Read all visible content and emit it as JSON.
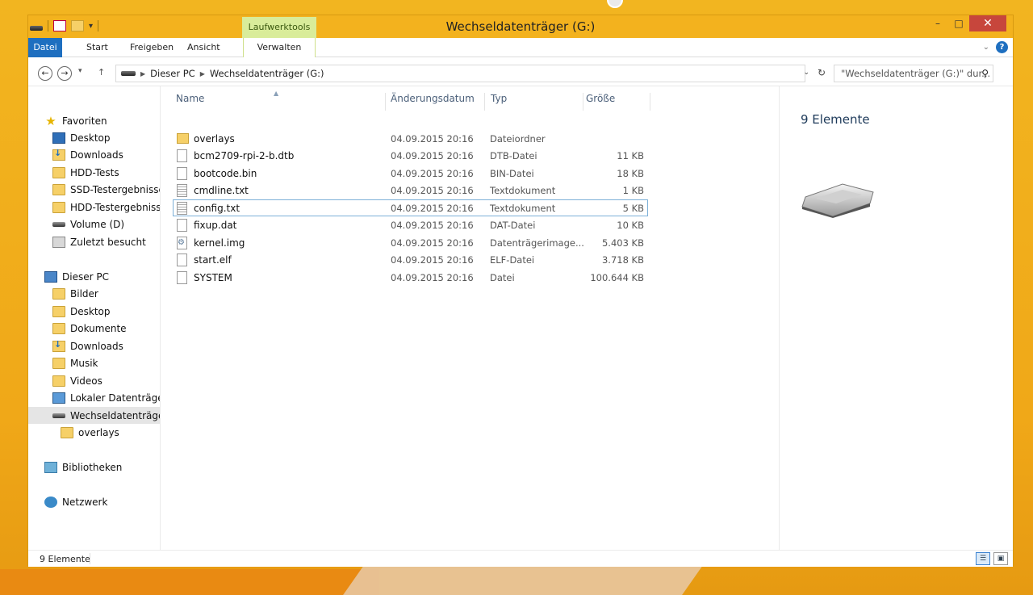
{
  "window": {
    "title": "Wechseldatenträger (G:)",
    "contextual_tab_group": "Laufwerktools"
  },
  "window_controls": {
    "minimize": "–",
    "maximize": "□",
    "close": "✕"
  },
  "quick_access": {
    "dropdown": "▾"
  },
  "ribbon": {
    "tabs": [
      "Datei",
      "Start",
      "Freigeben",
      "Ansicht",
      "Verwalten"
    ],
    "expand": "⌄",
    "help": "?"
  },
  "nav": {
    "back": "←",
    "forward": "→",
    "recent": "▾",
    "up": "↑"
  },
  "address": {
    "crumbs": [
      "Dieser PC",
      "Wechseldatenträger (G:)"
    ],
    "dropdown": "⌄",
    "refresh": "↻",
    "search_placeholder": "\"Wechseldatenträger (G:)\" dur...",
    "search_icon": "⚲"
  },
  "navpane": {
    "favorites": "Favoriten",
    "fav_items": [
      "Desktop",
      "Downloads",
      "HDD-Tests",
      "SSD-Testergebnisse",
      "HDD-Testergebnisse",
      "Volume (D)",
      "Zuletzt besucht"
    ],
    "this_pc": "Dieser PC",
    "pc_items": [
      "Bilder",
      "Desktop",
      "Dokumente",
      "Downloads",
      "Musik",
      "Videos",
      "Lokaler Datenträger",
      "Wechseldatenträger"
    ],
    "sub_item": "overlays",
    "libraries": "Bibliotheken",
    "network": "Netzwerk"
  },
  "columns": {
    "name": "Name",
    "date": "Änderungsdatum",
    "type": "Typ",
    "size": "Größe"
  },
  "files": [
    {
      "name": "overlays",
      "date": "04.09.2015 20:16",
      "type": "Dateiordner",
      "size": "",
      "icon": "folder-icon"
    },
    {
      "name": "bcm2709-rpi-2-b.dtb",
      "date": "04.09.2015 20:16",
      "type": "DTB-Datei",
      "size": "11 KB",
      "icon": "file-icon"
    },
    {
      "name": "bootcode.bin",
      "date": "04.09.2015 20:16",
      "type": "BIN-Datei",
      "size": "18 KB",
      "icon": "file-icon"
    },
    {
      "name": "cmdline.txt",
      "date": "04.09.2015 20:16",
      "type": "Textdokument",
      "size": "1 KB",
      "icon": "text-file-icon"
    },
    {
      "name": "config.txt",
      "date": "04.09.2015 20:16",
      "type": "Textdokument",
      "size": "5 KB",
      "icon": "text-file-icon",
      "selected": true
    },
    {
      "name": "fixup.dat",
      "date": "04.09.2015 20:16",
      "type": "DAT-Datei",
      "size": "10 KB",
      "icon": "file-icon"
    },
    {
      "name": "kernel.img",
      "date": "04.09.2015 20:16",
      "type": "Datenträgerimage...",
      "size": "5.403 KB",
      "icon": "disk-image-icon"
    },
    {
      "name": "start.elf",
      "date": "04.09.2015 20:16",
      "type": "ELF-Datei",
      "size": "3.718 KB",
      "icon": "file-icon"
    },
    {
      "name": "SYSTEM",
      "date": "04.09.2015 20:16",
      "type": "Datei",
      "size": "100.644 KB",
      "icon": "file-icon"
    }
  ],
  "preview": {
    "count": "9 Elemente"
  },
  "status": {
    "count": "9 Elemente"
  },
  "colors": {
    "accent": "#1e6fc0",
    "frame": "#f3b21e",
    "context_tab": "#d9ec9a",
    "close": "#c7463c"
  }
}
